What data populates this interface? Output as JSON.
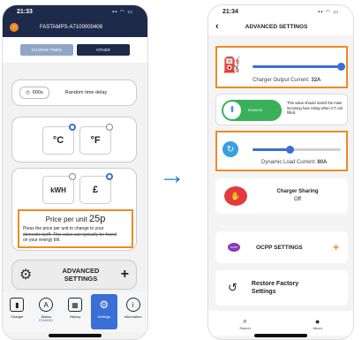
{
  "left_screen": {
    "status_time": "21:33",
    "header_title": "FASTAMPS-A7100000408",
    "tabs": [
      {
        "label": "CHARGE TIMES",
        "active": false
      },
      {
        "label": "OTHER",
        "active": true
      }
    ],
    "delay_value": "600s",
    "delay_label": "Random time delay",
    "temp_units": [
      {
        "label": "°C",
        "selected": true
      },
      {
        "label": "°F",
        "selected": false
      }
    ],
    "energy_units": [
      {
        "label": "kWH",
        "selected": false
      },
      {
        "label": "£",
        "selected": true
      }
    ],
    "price_title": "Price per unit",
    "price_value": "25p",
    "price_desc_a": "Press the price per unit to change to your",
    "price_desc_b": "domestic tariff. This value can typically be found",
    "price_desc_c": "on your energy bill.",
    "advanced_label_1": "ADVANCED",
    "advanced_label_2": "SETTINGS",
    "nav": [
      {
        "label": "Charger",
        "icon": "charger-icon",
        "active": false
      },
      {
        "label": "Status",
        "sub": "STANDBY",
        "icon": "status-icon",
        "active": false
      },
      {
        "label": "History",
        "icon": "calendar-icon",
        "active": false
      },
      {
        "label": "Settings",
        "icon": "gear-icon",
        "active": true
      },
      {
        "label": "Information",
        "icon": "info-icon",
        "active": false
      }
    ]
  },
  "right_screen": {
    "status_time": "21:34",
    "header_title": "ADVANCED SETTINGS",
    "charger_output_label": "Charger Output Current:",
    "charger_output_value": "32A",
    "charger_output_level": 1.0,
    "ct_toggle_label": "ENABLED",
    "ct_text": "This value should match the main incoming fuse rating when CT coil fitted.",
    "dynamic_load_label": "Dynamic Load Current:",
    "dynamic_load_value": "80A",
    "dynamic_load_level": 0.42,
    "sharing_title": "Charger Sharing",
    "sharing_value": "Off",
    "ocpp_label": "OCPP SETTINGS",
    "ocpp_icon_text": "OCPP",
    "restore_label_1": "Restore Factory",
    "restore_label_2": "Settings",
    "nav": [
      {
        "label": "Search",
        "icon": "search-icon"
      },
      {
        "label": "About",
        "icon": "info-icon"
      }
    ]
  },
  "colors": {
    "navy": "#1e2a4a",
    "accent": "#ef8a24",
    "blue": "#3a6fd6",
    "green": "#3ab05a"
  }
}
